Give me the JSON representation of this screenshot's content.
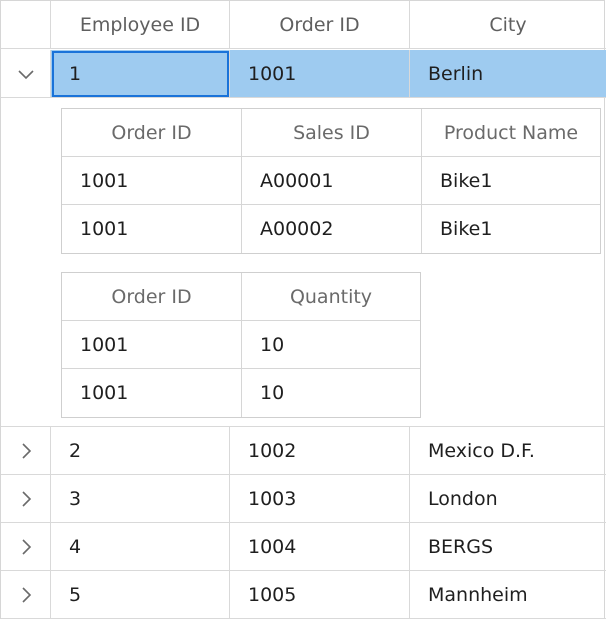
{
  "main_grid": {
    "columns": [
      "Employee ID",
      "Order ID",
      "City"
    ],
    "rows": [
      {
        "employee_id": "1",
        "order_id": "1001",
        "city": "Berlin"
      },
      {
        "employee_id": "2",
        "order_id": "1002",
        "city": "Mexico D.F."
      },
      {
        "employee_id": "3",
        "order_id": "1003",
        "city": "London"
      },
      {
        "employee_id": "4",
        "order_id": "1004",
        "city": "BERGS"
      },
      {
        "employee_id": "5",
        "order_id": "1005",
        "city": "Mannheim"
      }
    ]
  },
  "sales_grid": {
    "columns": [
      "Order ID",
      "Sales ID",
      "Product Name"
    ],
    "rows": [
      {
        "order_id": "1001",
        "sales_id": "A00001",
        "product_name": "Bike1"
      },
      {
        "order_id": "1001",
        "sales_id": "A00002",
        "product_name": "Bike1"
      }
    ]
  },
  "quantity_grid": {
    "columns": [
      "Order ID",
      "Quantity"
    ],
    "rows": [
      {
        "order_id": "1001",
        "quantity": "10"
      },
      {
        "order_id": "1001",
        "quantity": "10"
      }
    ]
  },
  "colors": {
    "selection": "#9ecbf0",
    "focus_border": "#1a73d9"
  },
  "icons": {
    "expanded": "chevron-down-icon",
    "collapsed": "chevron-right-icon"
  }
}
